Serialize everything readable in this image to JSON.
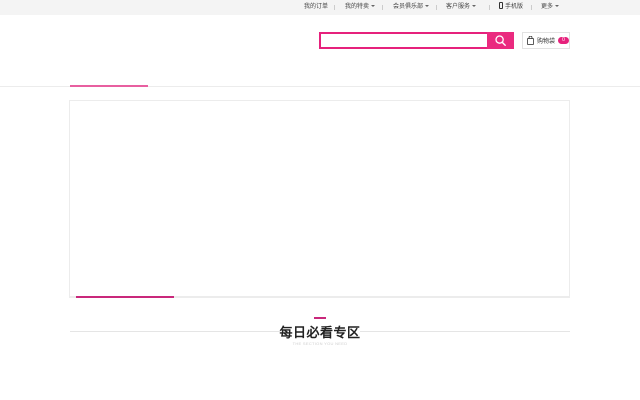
{
  "topbar": {
    "items": [
      {
        "label": "我的订单"
      },
      {
        "label": "我的特卖"
      },
      {
        "label": "会员俱乐部"
      },
      {
        "label": "客户服务"
      },
      {
        "label": "手机版"
      },
      {
        "label": "更多"
      }
    ]
  },
  "search": {
    "value": "",
    "placeholder": ""
  },
  "cart": {
    "label": "购物袋",
    "count": "0"
  },
  "section": {
    "title": "每日必看专区",
    "subtitle": "THE SECTION YOU NEED"
  },
  "colors": {
    "accent": "#e6217c",
    "accent_dark": "#c9287b",
    "topbar_bg": "#f4f4f4"
  }
}
